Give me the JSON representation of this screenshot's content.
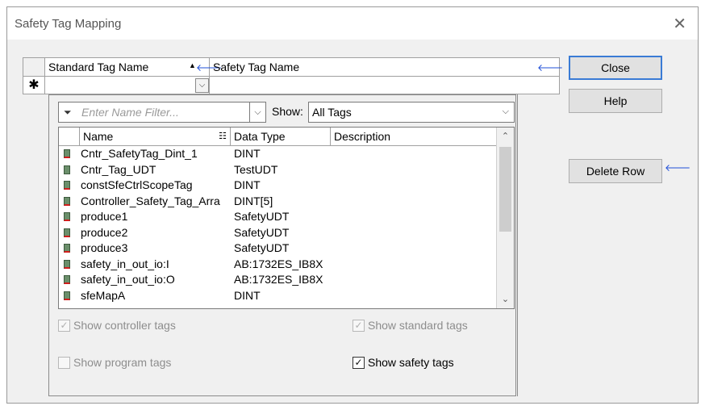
{
  "window": {
    "title": "Safety Tag Mapping",
    "close_glyph": "✕"
  },
  "grid": {
    "columns": [
      {
        "label": "Standard Tag Name",
        "sort_arrow": "▲",
        "arrow": "🡐"
      },
      {
        "label": "Safety Tag Name",
        "arrow": "🡐"
      }
    ],
    "new_row_marker": "✱",
    "combo_caret": "⌵"
  },
  "picker": {
    "filter_placeholder": "Enter Name Filter...",
    "show_label": "Show:",
    "show_value": "All Tags",
    "list_headers": {
      "name": "Name",
      "name_icon": "☷",
      "data_type": "Data Type",
      "description": "Description"
    },
    "rows": [
      {
        "name": "Cntr_SafetyTag_Dint_1",
        "type": "DINT",
        "safety": true
      },
      {
        "name": "Cntr_Tag_UDT",
        "type": "TestUDT",
        "safety": false
      },
      {
        "name": "constSfeCtrlScopeTag",
        "type": "DINT",
        "safety": true
      },
      {
        "name": "Controller_Safety_Tag_Arra",
        "type": "DINT[5]",
        "safety": true
      },
      {
        "name": "produce1",
        "type": "SafetyUDT",
        "safety": true
      },
      {
        "name": "produce2",
        "type": "SafetyUDT",
        "safety": true
      },
      {
        "name": "produce3",
        "type": "SafetyUDT",
        "safety": true
      },
      {
        "name": "safety_in_out_io:I",
        "type": "AB:1732ES_IB8X",
        "safety": true
      },
      {
        "name": "safety_in_out_io:O",
        "type": "AB:1732ES_IB8X",
        "safety": true
      },
      {
        "name": "sfeMapA",
        "type": "DINT",
        "safety": true
      }
    ],
    "checkboxes": {
      "controller": {
        "label": "Show controller tags",
        "checked": true,
        "enabled": false
      },
      "standard": {
        "label": "Show standard tags",
        "checked": true,
        "enabled": false
      },
      "program": {
        "label": "Show program tags",
        "checked": false,
        "enabled": false
      },
      "safety": {
        "label": "Show safety tags",
        "checked": true,
        "enabled": true
      }
    }
  },
  "buttons": {
    "close": "Close",
    "help": "Help",
    "delete_row": "Delete Row",
    "delete_arrow": "🡐"
  },
  "colors": {
    "accent_arrow": "#1f4fd8",
    "default_button_border": "#3a7bd5",
    "safety_marker": "#d21c1c"
  }
}
